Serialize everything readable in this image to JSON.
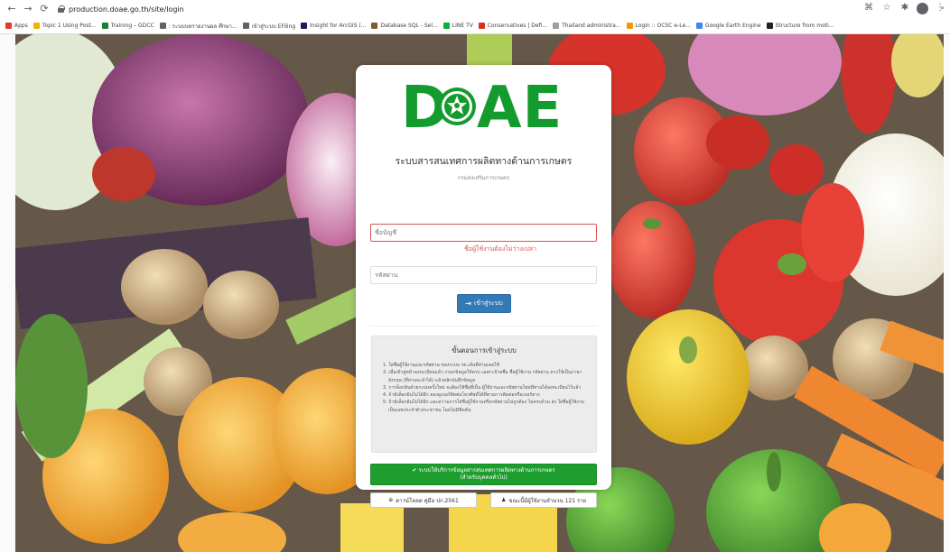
{
  "browser": {
    "url": "production.doae.go.th/site/login",
    "bookmarks": [
      {
        "label": "Apps",
        "color": "#e33b2e"
      },
      {
        "label": "Topic 1 Using Post...",
        "color": "#f0b400"
      },
      {
        "label": "Training – GDCC",
        "color": "#188038"
      },
      {
        "label": ": ระบบบทรายงานผล ศึกษา...",
        "color": "#5f6368"
      },
      {
        "label": "เข้าสู่ระบบ EFiling",
        "color": "#5f6368"
      },
      {
        "label": "Insight for ArcGIS (...",
        "color": "#1a1a5e"
      },
      {
        "label": "Database SQL - Sel...",
        "color": "#7b5e2b"
      },
      {
        "label": "LINE TV",
        "color": "#06b33a"
      },
      {
        "label": "Conservatives | Defi...",
        "color": "#d93025"
      },
      {
        "label": "Thailand administra...",
        "color": "#9aa0a6"
      },
      {
        "label": "Login :: OCSC e-Le...",
        "color": "#f29900"
      },
      {
        "label": "Google Earth Engine",
        "color": "#4285f4"
      },
      {
        "label": "Structure from moti...",
        "color": "#202124"
      }
    ]
  },
  "logo": {
    "left": "D",
    "right": "AE",
    "color": "#149b2e"
  },
  "login": {
    "system_title": "ระบบสารสนเทศการผลิตทางด้านการเกษตร",
    "department": "กรมส่งเสริมการเกษตร",
    "username_placeholder": "ชื่อบัญชี",
    "username_error": "ชื่อผู้ใช้งานต้องไม่ว่างเปล่า",
    "password_placeholder": "รหัสผ่าน",
    "login_button": "เข้าสู่ระบบ"
  },
  "steps": {
    "title": "ขั้นตอนการเข้าสู่ระบบ",
    "items": [
      "1. ใส่ชื่อผู้ใช้งานและรหัสผ่าน ของระบบ รต.เส้นที่ท่านเคยใช้",
      "2. เมื่อเข้าสู่หน้าลงทะเบียนแล้ว กรอกข้อมูลให้ครบ เฉพาะป้ายชื่อ ชื่อผู้ใช้งาน รหัสผ่าน ควรใช้เป็นภาษาอังกฤษ (ที่ท่านจะจำได้) แล้วคลิกบันทึกข้อมูล",
      "3. การล็อกอินด้วยระบบครั้งใหม่ จะต้องใช้ชื่อที่เป็น ผู้ใช้งานและรหัสผ่านใหม่ที่ท่านได้ลงทะเบียนไว้แล้ว",
      "4. ถ้ายังล็อกอินไม่ได้อีก ลองดูเบอร์ติดต่อโทรศัพท์ได้ที่ตามการติดต่อหรือเบอร์ทาง",
      "5. ถ้ายังล็อกอินไม่ได้อีก และความการใส่ชื่อผู้ใช้งานหรือรหัสผ่านไม่ถูกต้อง ไม่ครบถ้วน ส่ง ใส่ชื่อผู้ใช้งานเป็นเลขประจำตัวประชาชน โดยไม่มีขีดคั่น"
    ]
  },
  "services_button": {
    "line1": "ระบบให้บริการข้อมูลสารสนเทศการผลิตทางด้านการเกษตร",
    "line2": "(สำหรับบุคคลทั่วไป)"
  },
  "download_button": "ดาวน์โหลด คู่มือ ปก.2561",
  "users_button": "ขณะนี้มีผู้ใช้งานจำนวน 121 ราย"
}
